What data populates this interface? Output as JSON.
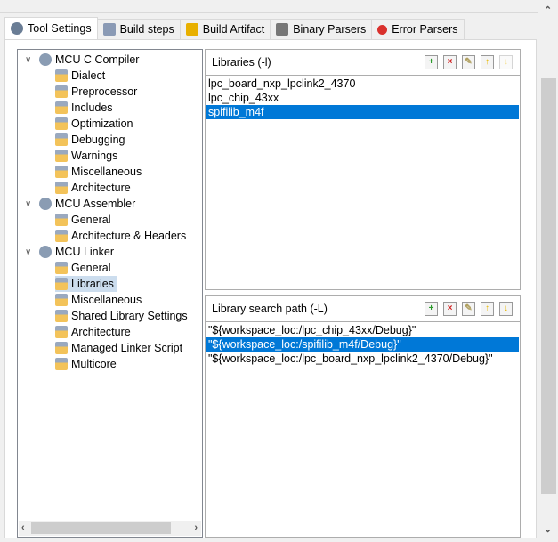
{
  "tabs": [
    {
      "label": "Tool Settings",
      "icon": "gear-icon",
      "active": true
    },
    {
      "label": "Build steps",
      "icon": "hammer-icon"
    },
    {
      "label": "Build Artifact",
      "icon": "trophy-icon"
    },
    {
      "label": "Binary Parsers",
      "icon": "binary-file-icon"
    },
    {
      "label": "Error Parsers",
      "icon": "error-icon"
    }
  ],
  "tree": [
    {
      "label": "MCU C Compiler",
      "level": 0,
      "expanded": true
    },
    {
      "label": "Dialect",
      "level": 1
    },
    {
      "label": "Preprocessor",
      "level": 1
    },
    {
      "label": "Includes",
      "level": 1
    },
    {
      "label": "Optimization",
      "level": 1
    },
    {
      "label": "Debugging",
      "level": 1
    },
    {
      "label": "Warnings",
      "level": 1
    },
    {
      "label": "Miscellaneous",
      "level": 1
    },
    {
      "label": "Architecture",
      "level": 1
    },
    {
      "label": "MCU Assembler",
      "level": 0,
      "expanded": true
    },
    {
      "label": "General",
      "level": 1
    },
    {
      "label": "Architecture & Headers",
      "level": 1
    },
    {
      "label": "MCU Linker",
      "level": 0,
      "expanded": true
    },
    {
      "label": "General",
      "level": 1
    },
    {
      "label": "Libraries",
      "level": 1,
      "selected": true
    },
    {
      "label": "Miscellaneous",
      "level": 1
    },
    {
      "label": "Shared Library Settings",
      "level": 1
    },
    {
      "label": "Architecture",
      "level": 1
    },
    {
      "label": "Managed Linker Script",
      "level": 1
    },
    {
      "label": "Multicore",
      "level": 1
    }
  ],
  "libraries": {
    "title": "Libraries (-l)",
    "items": [
      "lpc_board_nxp_lpclink2_4370",
      "lpc_chip_43xx",
      "spifilib_m4f"
    ],
    "selected": 2
  },
  "search_path": {
    "title": "Library search path (-L)",
    "items": [
      "\"${workspace_loc:/lpc_chip_43xx/Debug}\"",
      "\"${workspace_loc:/spifilib_m4f/Debug}\"",
      "\"${workspace_loc:/lpc_board_nxp_lpclink2_4370/Debug}\""
    ],
    "selected": 1
  },
  "toolbar": [
    "add-icon",
    "delete-icon",
    "edit-icon",
    "move-up-icon",
    "move-down-icon"
  ],
  "colors": {
    "selection": "#0078d7",
    "tree_selection": "#cde"
  }
}
